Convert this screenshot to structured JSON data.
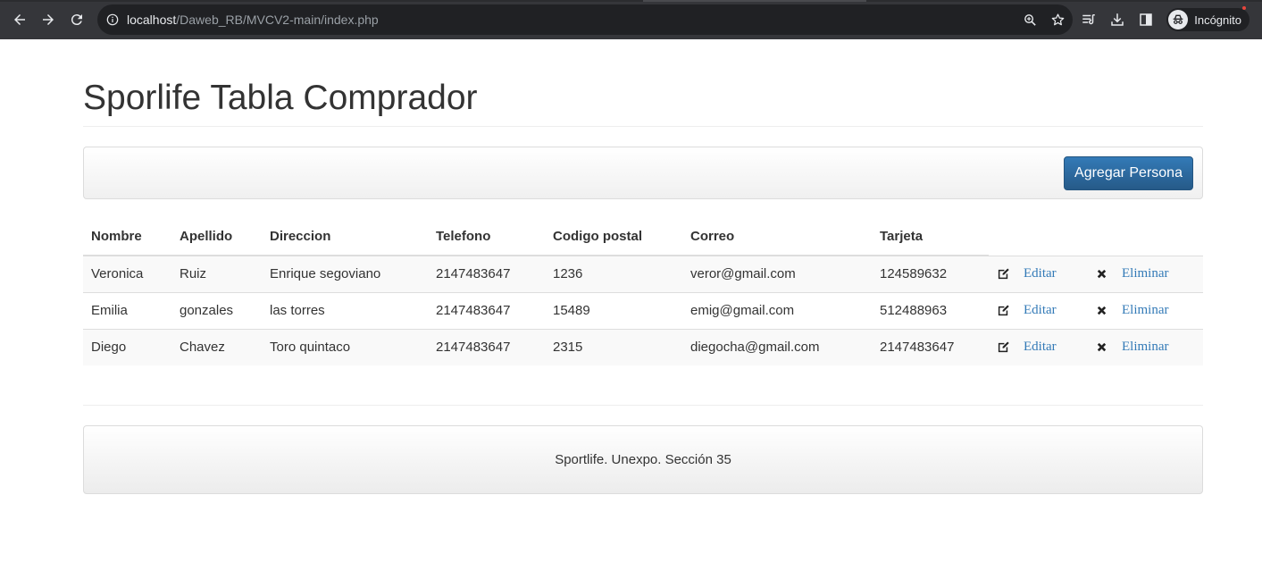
{
  "browser": {
    "url_host": "localhost",
    "url_path": "/Daweb_RB/MVCV2-main/index.php",
    "incognito_label": "Incógnito"
  },
  "page": {
    "title": "Sporlife Tabla Comprador",
    "add_button_label": "Agregar Persona"
  },
  "table": {
    "headers": [
      "Nombre",
      "Apellido",
      "Direccion",
      "Telefono",
      "Codigo postal",
      "Correo",
      "Tarjeta"
    ],
    "rows": [
      [
        "Veronica",
        "Ruiz",
        "Enrique segoviano",
        "2147483647",
        "1236",
        "veror@gmail.com",
        "124589632"
      ],
      [
        "Emilia",
        "gonzales",
        "las torres",
        "2147483647",
        "15489",
        "emig@gmail.com",
        "512488963"
      ],
      [
        "Diego",
        "Chavez",
        "Toro quintaco",
        "2147483647",
        "2315",
        "diegocha@gmail.com",
        "2147483647"
      ]
    ],
    "edit_label": "Editar",
    "delete_label": "Eliminar"
  },
  "footer": {
    "text": "Sportlife. Unexpo. Sección 35"
  },
  "colors": {
    "primary": "#337ab7",
    "chrome_bg": "#35363a",
    "omnibox_bg": "#202124"
  }
}
